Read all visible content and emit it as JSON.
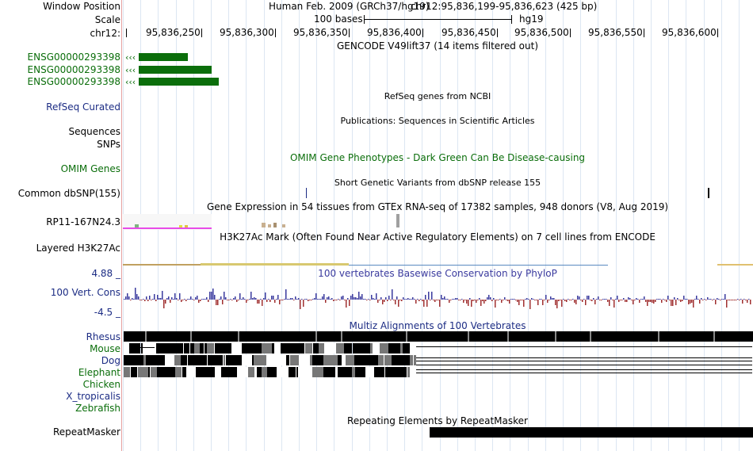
{
  "header": {
    "window_position_label": "Window Position",
    "assembly": "Human Feb. 2009 (GRCh37/hg19)",
    "position": "chr12:95,836,199-95,836,623 (425 bp)",
    "scale_label": "Scale",
    "scale_value": "100 bases",
    "scale_db": "hg19",
    "chrom_label": "chr12:",
    "ticks": [
      "95,836,250",
      "95,836,300",
      "95,836,350",
      "95,836,400",
      "95,836,450",
      "95,836,500",
      "95,836,550",
      "95,836,600"
    ]
  },
  "gencode": {
    "title": "GENCODE V49lift37 (14 items filtered out)",
    "items": [
      "ENSG00000293398",
      "ENSG00000293398",
      "ENSG00000293398"
    ],
    "color": "#0b6e0b"
  },
  "tracks": {
    "refseq": {
      "label": "RefSeq Curated",
      "title": "RefSeq genes from NCBI"
    },
    "publications": {
      "label": "Sequences",
      "title": "Publications: Sequences in Scientific Articles"
    },
    "snps": {
      "label": "SNPs"
    },
    "omim": {
      "label": "OMIM Genes",
      "title": "OMIM Gene Phenotypes - Dark Green Can Be Disease-causing"
    },
    "dbsnp": {
      "label": "Common dbSNP(155)",
      "title": "Short Genetic Variants from dbSNP release 155"
    },
    "gtex": {
      "label": "RP11-167N24.3",
      "title": "Gene Expression in 54 tissues from GTEx RNA-seq of 17382 samples, 948 donors (V8, Aug 2019)"
    },
    "h3k27ac": {
      "label": "Layered H3K27Ac",
      "title": "H3K27Ac Mark (Often Found Near Active Regulatory Elements) on 7 cell lines from ENCODE"
    },
    "conservation": {
      "label": "100 Vert. Cons",
      "max": "4.88 _",
      "min": "-4.5 _",
      "title": "100 vertebrates Basewise Conservation by PhyloP"
    },
    "multiz": {
      "title": "Multiz Alignments of 100 Vertebrates",
      "species": [
        "Rhesus",
        "Mouse",
        "Dog",
        "Elephant",
        "Chicken",
        "X_tropicalis",
        "Zebrafish"
      ]
    },
    "repeatmasker": {
      "label": "RepeatMasker",
      "title": "Repeating Elements by RepeatMasker"
    }
  },
  "colors": {
    "green_label": "#0b6e0b",
    "blue_label": "#1c2c84",
    "cons_blue": "#3a3a9e",
    "cons_red": "#a03030"
  }
}
